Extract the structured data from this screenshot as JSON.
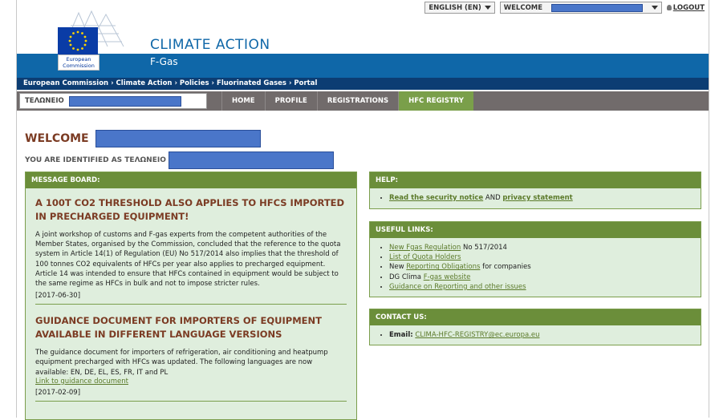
{
  "topbar": {
    "language": "ENGLISH (EN)",
    "welcome_label": "WELCOME",
    "logout": "LOGOUT"
  },
  "header": {
    "logo_line1": "European",
    "logo_line2": "Commission",
    "title": "CLIMATE ACTION",
    "subtitle": "F-Gas"
  },
  "breadcrumb": [
    "European Commission",
    "Climate Action",
    "Policies",
    "Fluorinated Gases",
    "Portal"
  ],
  "nav": {
    "user_label": "ΤΕΛΩΝΕΙΟ",
    "items": [
      "HOME",
      "PROFILE",
      "REGISTRATIONS",
      "HFC REGISTRY"
    ],
    "active": "HFC REGISTRY"
  },
  "welcome": {
    "heading": "WELCOME",
    "identified": "YOU ARE IDENTIFIED AS ΤΕΛΩΝΕΙΟ"
  },
  "message_board": {
    "title": "MESSAGE BOARD:",
    "news": [
      {
        "title": "A 100T CO2 THRESHOLD ALSO APPLIES TO HFCS IMPORTED IN PRECHARGED EQUIPMENT!",
        "text": "A joint workshop of customs and F-gas experts from the competent authorities of the Member States, organised by the Commission, concluded that the reference to the quota system in Article 14(1) of Regulation (EU) No 517/2014 also implies that the threshold of 100 tonnes CO2 equivalents of HFCs per year also applies to precharged equipment. Article 14 was intended to ensure that HFCs contained in equipment would be subject to the same regime as HFCs in bulk and not to impose stricter rules.",
        "date": "[2017-06-30]"
      },
      {
        "title": "GUIDANCE DOCUMENT FOR IMPORTERS OF EQUIPMENT AVAILABLE IN DIFFERENT LANGUAGE VERSIONS",
        "text": "The guidance document for importers of refrigeration, air conditioning and heatpump equipment precharged with HFCs was updated. The following languages are now available: EN, DE, EL, ES, FR, IT and PL",
        "link": "Link to guidance document",
        "date": "[2017-02-09]"
      }
    ]
  },
  "help": {
    "title": "HELP:",
    "link1": "Read the security notice",
    "and": "AND",
    "link2": "privacy statement"
  },
  "useful_links": {
    "title": "USEFUL LINKS:",
    "l1_link": "New Fgas Regulation",
    "l1_text": "No 517/2014",
    "l2_link": "List of Quota Holders",
    "l3_pre": "New",
    "l3_link": "Reporting Obligations",
    "l3_text": "for companies",
    "l4_pre": "DG Clima",
    "l4_link": "F-gas website",
    "l5_link": "Guidance on Reporting and other issues"
  },
  "contact": {
    "title": "CONTACT US:",
    "email_label": "Email:",
    "email": "CLIMA-HFC-REGISTRY@ec.europa.eu"
  }
}
